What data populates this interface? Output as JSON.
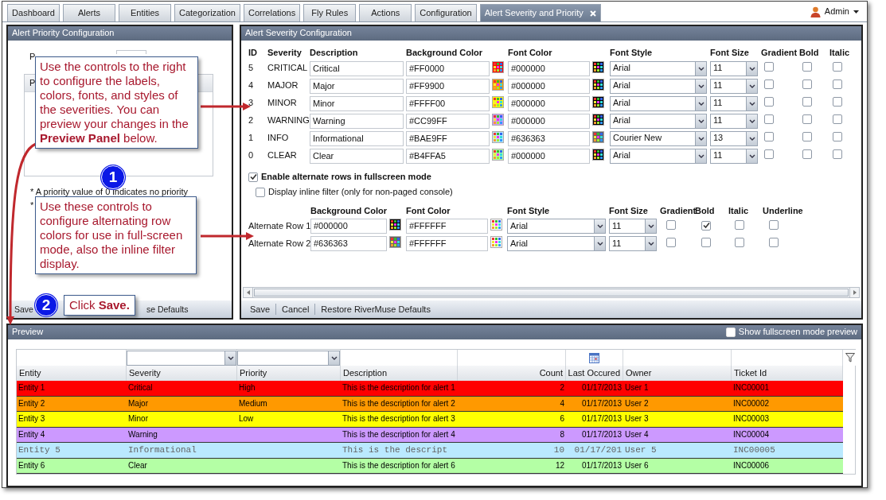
{
  "tabs": [
    {
      "label": "Dashboard",
      "selected": false
    },
    {
      "label": "Alerts",
      "selected": false
    },
    {
      "label": "Entities",
      "selected": false
    },
    {
      "label": "Categorization",
      "selected": false
    },
    {
      "label": "Correlations",
      "selected": false
    },
    {
      "label": "Fly Rules",
      "selected": false
    },
    {
      "label": "Actions",
      "selected": false
    },
    {
      "label": "Configuration",
      "selected": false
    },
    {
      "label": "Alert Severity and Priority",
      "selected": true
    }
  ],
  "user": {
    "name": "Admin"
  },
  "priority_panel": {
    "title": "Alert Priority Configuration",
    "field_label": "P",
    "grid_header": "P",
    "notes": [
      "* A priority value of 0 indicates no priority",
      "*"
    ],
    "footer": [
      "Save",
      "se Defaults"
    ]
  },
  "severity_panel": {
    "title": "Alert Severity Configuration",
    "columns": [
      "ID",
      "Severity",
      "Description",
      "Background Color",
      "Font Color",
      "Font Style",
      "Font Size",
      "Gradient",
      "Bold",
      "Italic"
    ],
    "rows": [
      {
        "id": "5",
        "severity": "CRITICAL",
        "description": "Critical",
        "background_color": "#FF0000",
        "font_color": "#000000",
        "font_style": "Arial",
        "font_size": "11",
        "gradient": false,
        "bold": false,
        "italic": false
      },
      {
        "id": "4",
        "severity": "MAJOR",
        "description": "Major",
        "background_color": "#FF9900",
        "font_color": "#000000",
        "font_style": "Arial",
        "font_size": "11",
        "gradient": false,
        "bold": false,
        "italic": false
      },
      {
        "id": "3",
        "severity": "MINOR",
        "description": "Minor",
        "background_color": "#FFFF00",
        "font_color": "#000000",
        "font_style": "Arial",
        "font_size": "11",
        "gradient": false,
        "bold": false,
        "italic": false
      },
      {
        "id": "2",
        "severity": "WARNING",
        "description": "Warning",
        "background_color": "#CC99FF",
        "font_color": "#000000",
        "font_style": "Arial",
        "font_size": "11",
        "gradient": false,
        "bold": false,
        "italic": false
      },
      {
        "id": "1",
        "severity": "INFO",
        "description": "Informational",
        "background_color": "#BAE9FF",
        "font_color": "#636363",
        "font_style": "Courier New",
        "font_size": "13",
        "gradient": false,
        "bold": false,
        "italic": false
      },
      {
        "id": "0",
        "severity": "CLEAR",
        "description": "Clear",
        "background_color": "#B4FFA5",
        "font_color": "#000000",
        "font_style": "Arial",
        "font_size": "11",
        "gradient": false,
        "bold": false,
        "italic": false
      }
    ],
    "alternate_rows": {
      "label": "Enable alternate rows in fullscreen mode",
      "checked": true
    },
    "inline_filter": {
      "label": "Display inline filter (only for non-paged console)",
      "checked": false
    },
    "alt_columns": [
      "Background Color",
      "Font Color",
      "Font Style",
      "Font Size",
      "Gradient",
      "Bold",
      "Italic",
      "Underline"
    ],
    "alt_rows": [
      {
        "label": "Alternate Row 1",
        "background_color": "#000000",
        "font_color": "#FFFFFF",
        "font_style": "Arial",
        "font_size": "11",
        "gradient": false,
        "bold": true,
        "italic": false,
        "underline": false
      },
      {
        "label": "Alternate Row 2",
        "background_color": "#636363",
        "font_color": "#FFFFFF",
        "font_style": "Arial",
        "font_size": "11",
        "gradient": false,
        "bold": false,
        "italic": false,
        "underline": false
      }
    ],
    "footer": [
      "Save",
      "Cancel",
      "Restore RiverMuse Defaults"
    ]
  },
  "preview": {
    "title": "Preview",
    "fullscreen": {
      "label": "Show fullscreen mode preview",
      "checked": false
    },
    "columns": [
      "Entity",
      "Severity",
      "Priority",
      "Description",
      "Count",
      "Last Occured",
      "Owner",
      "Ticket Id"
    ],
    "rows": [
      {
        "color": "#ff0000",
        "kind": "plain",
        "cells": [
          "Entity 1",
          "Critical",
          "High",
          "This is the description for alert 1",
          "2",
          "01/17/2013",
          "User 1",
          "INC00001"
        ]
      },
      {
        "color": "#ff9900",
        "kind": "plain",
        "cells": [
          "Entity 2",
          "Major",
          "Medium",
          "This is the description for alert 2",
          "4",
          "01/17/2013",
          "User 2",
          "INC00002"
        ]
      },
      {
        "color": "#ffff00",
        "kind": "plain",
        "cells": [
          "Entity 3",
          "Minor",
          "Low",
          "This is the description for alert 3",
          "6",
          "01/17/2013",
          "User 3",
          "INC00003"
        ]
      },
      {
        "color": "#cc99ff",
        "kind": "plain",
        "cells": [
          "Entity 4",
          "Warning",
          "",
          "This is the description for alert 4",
          "8",
          "01/17/2013",
          "User 4",
          "INC00004"
        ]
      },
      {
        "color": "#bae9ff",
        "kind": "typewriter",
        "cells": [
          "Entity 5",
          "Informational",
          "",
          "This is the descript",
          "10",
          "01/17/201",
          "User 5",
          "INC00005"
        ]
      },
      {
        "color": "#b4ffa5",
        "kind": "plain",
        "cells": [
          "Entity 6",
          "Clear",
          "",
          "This is the description for alert 6",
          "12",
          "01/17/2013",
          "User 6",
          "INC00006"
        ]
      }
    ]
  },
  "callouts": [
    {
      "text": "Use the controls to the right to configure the labels, colors, fonts, and styles of the severities. You can preview your changes in the **Preview Panel** below."
    },
    {
      "text": "Use these controls to configure alternating row colors for use in full-screen mode, also the inline filter display."
    }
  ],
  "steps": [
    {
      "number": "1"
    },
    {
      "number": "2",
      "label": "Click **Save.**"
    }
  ]
}
